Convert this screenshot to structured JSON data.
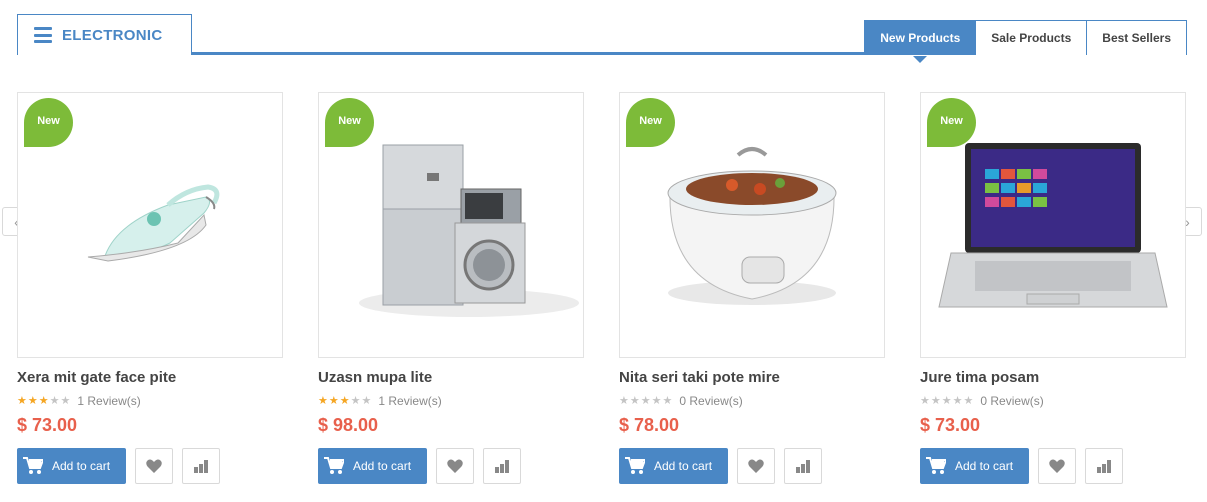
{
  "header": {
    "category_title": "ELECTRONIC",
    "tabs": [
      {
        "label": "New Products",
        "active": true
      },
      {
        "label": "Sale Products",
        "active": false
      },
      {
        "label": "Best Sellers",
        "active": false
      }
    ]
  },
  "nav": {
    "prev_icon": "chevron-left-icon",
    "next_icon": "chevron-right-icon",
    "prev_glyph": "‹",
    "next_glyph": "›"
  },
  "colors": {
    "accent": "#4a87c5",
    "badge": "#7dbb39",
    "price": "#e8604c",
    "star_on": "#f5a623",
    "star_off": "#c4c4c4"
  },
  "products": [
    {
      "badge": "New",
      "name": "Xera mit gate face pite",
      "rating": 3,
      "reviews": "1 Review(s)",
      "price": "$ 73.00",
      "cart_label": "Add to cart",
      "image": "clothes-iron"
    },
    {
      "badge": "New",
      "name": "Uzasn mupa lite",
      "rating": 3,
      "reviews": "1 Review(s)",
      "price": "$ 98.00",
      "cart_label": "Add to cart",
      "image": "appliances-fridge-washer-microwave"
    },
    {
      "badge": "New",
      "name": "Nita seri taki pote mire",
      "rating": 0,
      "reviews": "0 Review(s)",
      "price": "$ 78.00",
      "cart_label": "Add to cart",
      "image": "slow-cooker"
    },
    {
      "badge": "New",
      "name": "Jure tima posam",
      "rating": 0,
      "reviews": "0 Review(s)",
      "price": "$ 73.00",
      "cart_label": "Add to cart",
      "image": "laptop"
    }
  ]
}
